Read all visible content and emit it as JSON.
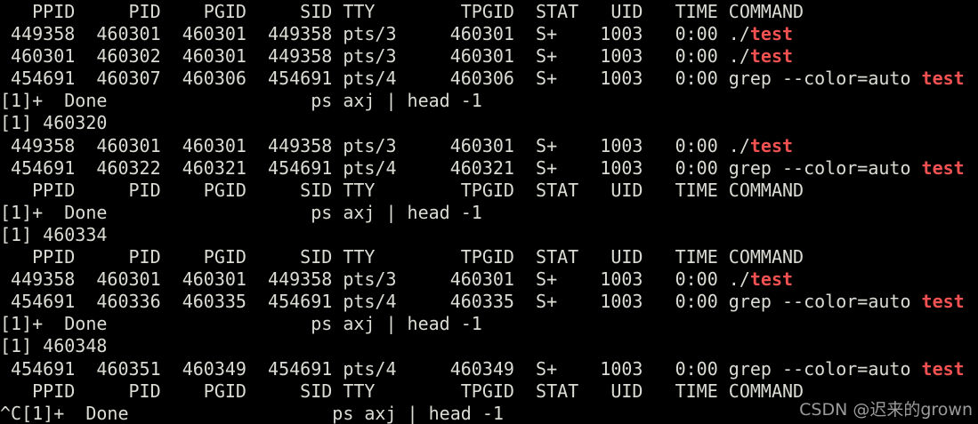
{
  "colors": {
    "background": "#000000",
    "foreground": "#dcdcd5",
    "grep_match_red": "#f25151",
    "watermark_gray": "#9b9b9b"
  },
  "watermark": {
    "text": "CSDN @迟来的grown"
  },
  "terminal": {
    "lines": [
      {
        "segments": [
          {
            "t": "   PPID     PID    PGID     SID TTY        TPGID  STAT   UID   TIME COMMAND"
          }
        ]
      },
      {
        "segments": [
          {
            "t": " 449358  460301  460301  449358 pts/3     460301  S+    1003   0:00 ./"
          },
          {
            "t": "test",
            "red": true
          }
        ]
      },
      {
        "segments": [
          {
            "t": " 460301  460302  460301  449358 pts/3     460301  S+    1003   0:00 ./"
          },
          {
            "t": "test",
            "red": true
          }
        ]
      },
      {
        "segments": [
          {
            "t": " 454691  460307  460306  454691 pts/4     460306  S+    1003   0:00 grep --color=auto "
          },
          {
            "t": "test",
            "red": true
          }
        ]
      },
      {
        "segments": [
          {
            "t": "[1]+  Done                   ps axj | head -1"
          }
        ]
      },
      {
        "segments": [
          {
            "t": "[1] 460320"
          }
        ]
      },
      {
        "segments": [
          {
            "t": " 449358  460301  460301  449358 pts/3     460301  S+    1003   0:00 ./"
          },
          {
            "t": "test",
            "red": true
          }
        ]
      },
      {
        "segments": [
          {
            "t": " 454691  460322  460321  454691 pts/4     460321  S+    1003   0:00 grep --color=auto "
          },
          {
            "t": "test",
            "red": true
          }
        ]
      },
      {
        "segments": [
          {
            "t": "   PPID     PID    PGID     SID TTY        TPGID  STAT   UID   TIME COMMAND"
          }
        ]
      },
      {
        "segments": [
          {
            "t": "[1]+  Done                   ps axj | head -1"
          }
        ]
      },
      {
        "segments": [
          {
            "t": "[1] 460334"
          }
        ]
      },
      {
        "segments": [
          {
            "t": "   PPID     PID    PGID     SID TTY        TPGID  STAT   UID   TIME COMMAND"
          }
        ]
      },
      {
        "segments": [
          {
            "t": " 449358  460301  460301  449358 pts/3     460301  S+    1003   0:00 ./"
          },
          {
            "t": "test",
            "red": true
          }
        ]
      },
      {
        "segments": [
          {
            "t": " 454691  460336  460335  454691 pts/4     460335  S+    1003   0:00 grep --color=auto "
          },
          {
            "t": "test",
            "red": true
          }
        ]
      },
      {
        "segments": [
          {
            "t": "[1]+  Done                   ps axj | head -1"
          }
        ]
      },
      {
        "segments": [
          {
            "t": "[1] 460348"
          }
        ]
      },
      {
        "segments": [
          {
            "t": " 454691  460351  460349  454691 pts/4     460349  S+    1003   0:00 grep --color=auto "
          },
          {
            "t": "test",
            "red": true
          }
        ]
      },
      {
        "segments": [
          {
            "t": "   PPID     PID    PGID     SID TTY        TPGID  STAT   UID   TIME COMMAND"
          }
        ]
      },
      {
        "segments": [
          {
            "t": "^C[1]+  Done                   ps axj | head -1"
          }
        ]
      }
    ]
  }
}
